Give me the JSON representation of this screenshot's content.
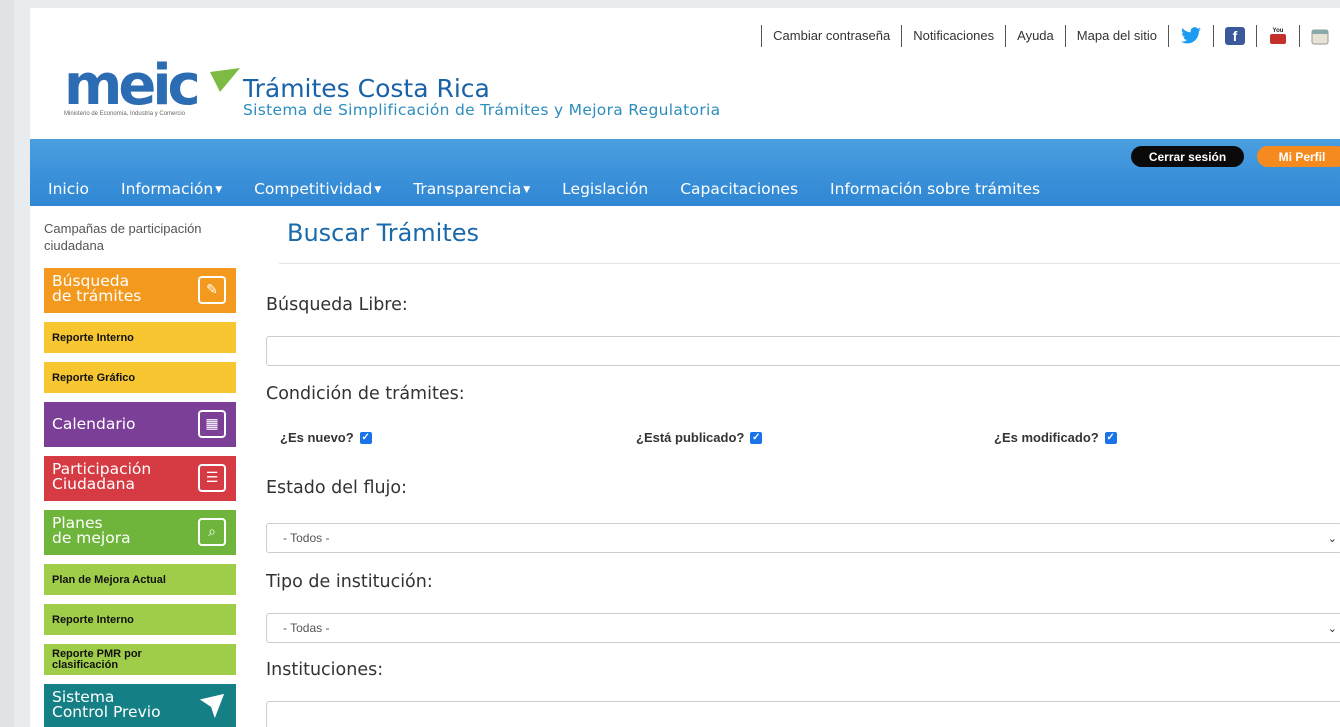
{
  "toplinks": {
    "change_password": "Cambiar contraseña",
    "notifications": "Notificaciones",
    "help": "Ayuda",
    "sitemap": "Mapa del sitio"
  },
  "header": {
    "logo_text": "meic",
    "logo_subtext": "Ministerio de Economía, Industria y Comercio",
    "title": "Trámites Costa Rica",
    "subtitle": "Sistema de Simplificación de Trámites y Mejora Regulatoria"
  },
  "nav": {
    "items": [
      {
        "label": "Inicio",
        "dropdown": false
      },
      {
        "label": "Información",
        "dropdown": true
      },
      {
        "label": "Competitividad",
        "dropdown": true
      },
      {
        "label": "Transparencia",
        "dropdown": true
      },
      {
        "label": "Legislación",
        "dropdown": false
      },
      {
        "label": "Capacitaciones",
        "dropdown": false
      },
      {
        "label": "Información sobre trámites",
        "dropdown": false
      }
    ],
    "logout": "Cerrar sesión",
    "profile": "Mi Perfil"
  },
  "sidebar": {
    "campaigns": "Campañas de participación ciudadana",
    "search_tile": [
      "Búsqueda",
      "de trámites"
    ],
    "internal_report": "Reporte Interno",
    "graphic_report": "Reporte Gráfico",
    "calendar": "Calendario",
    "participation": [
      "Participación",
      "Ciudadana"
    ],
    "plans": [
      "Planes",
      "de mejora"
    ],
    "current_plan": "Plan de Mejora Actual",
    "internal_report_2": "Reporte Interno",
    "pmr_report": "Reporte PMR por clasificación",
    "control": [
      "Sistema",
      "Control Previo"
    ]
  },
  "main": {
    "title": "Buscar Trámites",
    "free_search_label": "Búsqueda Libre:",
    "free_search_value": "",
    "condition_label": "Condición de trámites:",
    "is_new": "¿Es nuevo?",
    "is_published": "¿Está publicado?",
    "is_modified": "¿Es modificado?",
    "flow_state_label": "Estado del flujo:",
    "flow_state_value": "- Todos -",
    "institution_type_label": "Tipo de institución:",
    "institution_type_value": "- Todas -",
    "institutions_label": "Instituciones:",
    "institutions_value": ""
  },
  "colors": {
    "nav_blue": "#2f86d3",
    "title_blue": "#1a6aab",
    "orange": "#f39a1e",
    "checkbox": "#1a73e8"
  }
}
